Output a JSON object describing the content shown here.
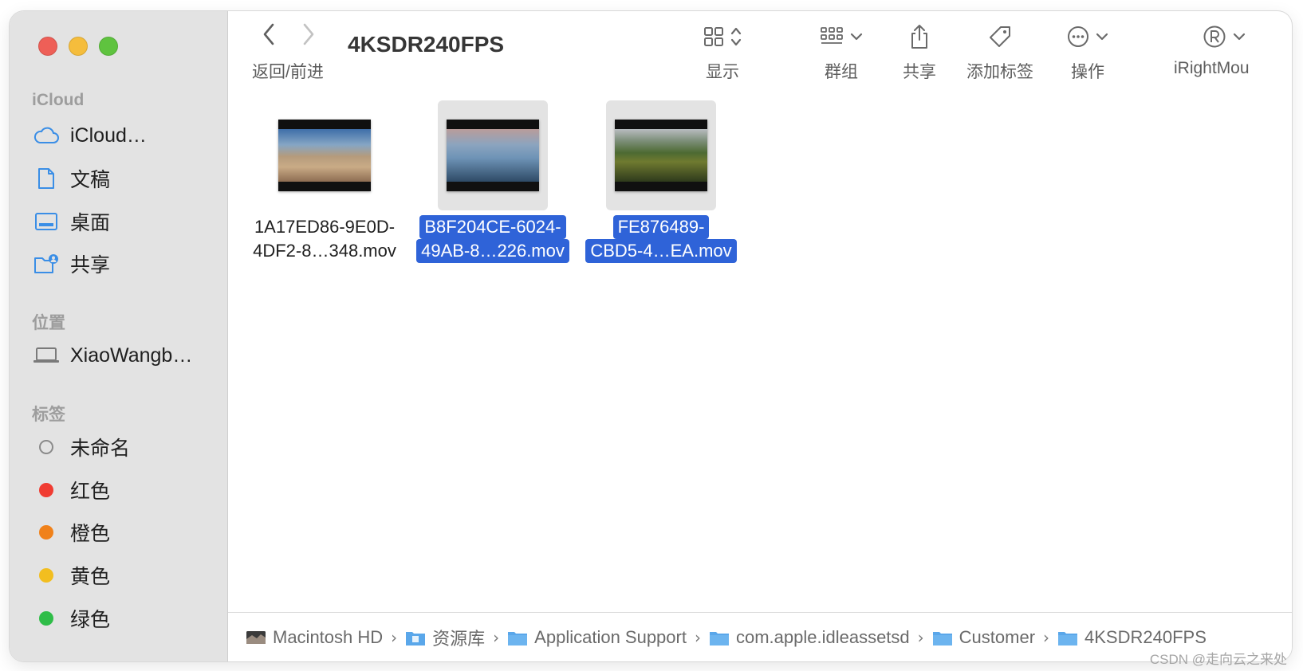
{
  "window": {
    "title": "4KSDR240FPS"
  },
  "nav": {
    "back_forward_label": "返回/前进"
  },
  "toolbar": {
    "view_label": "显示",
    "group_label": "群组",
    "share_label": "共享",
    "tags_label": "添加标签",
    "action_label": "操作",
    "extension_label": "iRightMou"
  },
  "sidebar": {
    "icloud_header": "iCloud",
    "icloud_items": [
      {
        "label": "iCloud…",
        "icon": "cloud-icon"
      },
      {
        "label": "文稿",
        "icon": "document-icon"
      },
      {
        "label": "桌面",
        "icon": "desktop-icon"
      },
      {
        "label": "共享",
        "icon": "shared-folder-icon"
      }
    ],
    "locations_header": "位置",
    "location_items": [
      {
        "label": "XiaoWangb…",
        "icon": "laptop-icon"
      }
    ],
    "tags_header": "标签",
    "tag_items": [
      {
        "label": "未命名",
        "color": ""
      },
      {
        "label": "红色",
        "color": "#f03c32"
      },
      {
        "label": "橙色",
        "color": "#f0811a"
      },
      {
        "label": "黄色",
        "color": "#f2be1f"
      },
      {
        "label": "绿色",
        "color": "#2fbd48"
      }
    ]
  },
  "files": [
    {
      "name_line1": "1A17ED86-9E0D-",
      "name_line2": "4DF2-8…348.mov",
      "selected": false
    },
    {
      "name_line1": "B8F204CE-6024-",
      "name_line2": "49AB-8…226.mov",
      "selected": true
    },
    {
      "name_line1": "FE876489-",
      "name_line2": "CBD5-4…EA.mov",
      "selected": true
    }
  ],
  "pathbar": {
    "crumbs": [
      "Macintosh HD",
      "资源库",
      "Application Support",
      "com.apple.idleassetsd",
      "Customer",
      "4KSDR240FPS"
    ]
  },
  "watermark": "CSDN @走向云之来处"
}
